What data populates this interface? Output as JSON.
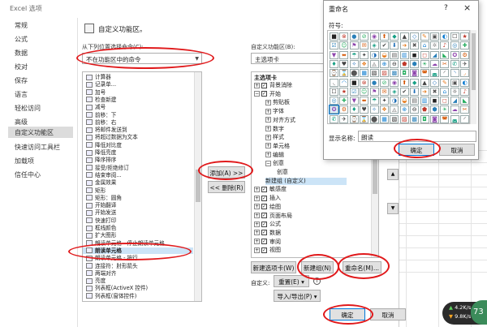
{
  "window": {
    "title": "Excel 选项"
  },
  "nav": {
    "items": [
      "常规",
      "公式",
      "数据",
      "校对",
      "保存",
      "语言",
      "轻松访问",
      "高级",
      "自定义功能区",
      "快速访问工具栏",
      "加载项",
      "信任中心"
    ],
    "active_index": 8
  },
  "main": {
    "heading": "自定义功能区。",
    "from_label": "从下列位置选择命令(C):",
    "from_value": "不在功能区中的命令",
    "customize_label": "自定义功能区(B):",
    "customize_value": "主选项卡",
    "commands": [
      "计算器",
      "记录单...",
      "加号",
      "检查新建",
      "减号",
      "前移：下",
      "前移：右",
      "将邮件发送到",
      "将超过数据为文本",
      "降低对比度",
      "降低亮度",
      "降序排序",
      "接受/拒绝修订",
      "结束审阅...",
      "金属效果",
      "矩形",
      "矩形：圆角",
      "开始翻译",
      "开始发送",
      "快速打印",
      "框线颜色",
      "扩大图形",
      "朗读单元格 - 停止朗读单元格",
      "朗读单元格",
      "朗读单元格 - 按行",
      "连接符：肘形箭头",
      "两端对齐",
      "亮度",
      "列表框(ActiveX 控件)",
      "列表框(窗体控件)"
    ],
    "selected_command": "朗读单元格",
    "add_button": "添加(A) >>",
    "remove_button": "<< 删除(R)",
    "tabs_header": "主选项卡",
    "tree": [
      {
        "level": 0,
        "exp": "⊞",
        "check": true,
        "label": "背景消除"
      },
      {
        "level": 0,
        "exp": "⊟",
        "check": true,
        "label": "开始"
      },
      {
        "level": 1,
        "exp": "⊞",
        "label": "剪贴板"
      },
      {
        "level": 1,
        "exp": "⊞",
        "label": "字体"
      },
      {
        "level": 1,
        "exp": "⊞",
        "label": "对齐方式"
      },
      {
        "level": 1,
        "exp": "⊞",
        "label": "数字"
      },
      {
        "level": 1,
        "exp": "⊞",
        "label": "样式"
      },
      {
        "level": 1,
        "exp": "⊞",
        "label": "单元格"
      },
      {
        "level": 1,
        "exp": "⊞",
        "label": "编辑"
      },
      {
        "level": 1,
        "exp": "⊟",
        "label": "创意"
      },
      {
        "level": 2,
        "label": "创意"
      },
      {
        "level": 1,
        "label": "新建组 (自定义)",
        "selected": true
      },
      {
        "level": 0,
        "exp": "⊞",
        "check": true,
        "label": "敏感度"
      },
      {
        "level": 0,
        "exp": "⊞",
        "check": true,
        "label": "插入"
      },
      {
        "level": 0,
        "exp": "⊞",
        "check": true,
        "label": "绘图"
      },
      {
        "level": 0,
        "exp": "⊞",
        "check": true,
        "label": "页面布局"
      },
      {
        "level": 0,
        "exp": "⊞",
        "check": true,
        "label": "公式"
      },
      {
        "level": 0,
        "exp": "⊞",
        "check": true,
        "label": "数据"
      },
      {
        "level": 0,
        "exp": "⊞",
        "check": true,
        "label": "审阅"
      },
      {
        "level": 0,
        "exp": "⊞",
        "check": true,
        "label": "视图"
      }
    ],
    "new_tab_button": "新建选项卡(W)",
    "new_group_button": "新建组(N)",
    "rename_button": "重命名(M)...",
    "customize_label2": "自定义:",
    "reset_value": "重置(E) ▾",
    "import_export": "导入/导出(P) ▾",
    "ok": "确定",
    "cancel": "取消"
  },
  "rename_dialog": {
    "title": "重命名",
    "help": "?",
    "close": "×",
    "symbol_label": "符号:",
    "display_name_label": "显示名称:",
    "display_name_value": "朗读",
    "ok": "确定",
    "cancel": "取消"
  },
  "taskbar_widget": {
    "up": "4.2K/s",
    "down": "9.8K/s",
    "percent": "73"
  },
  "colors": {
    "accent": "#0078d7",
    "annotation": "#e0191b",
    "selection": "#cce4f7"
  }
}
